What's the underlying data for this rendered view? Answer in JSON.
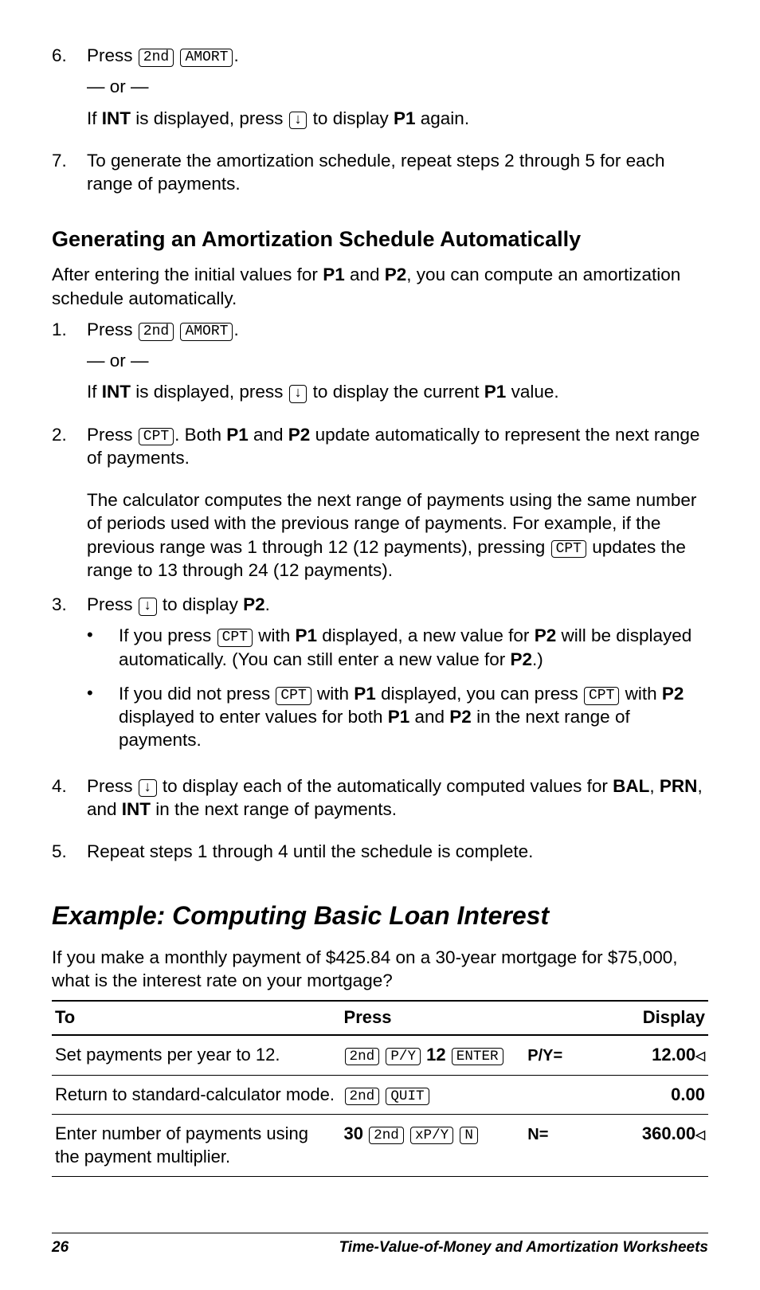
{
  "steps_top": [
    {
      "num": "6.",
      "parts": [
        "Press ",
        "[2nd]",
        " ",
        "[AMORT]",
        "."
      ],
      "or": "— or —",
      "parts2": [
        "If ",
        "**INT**",
        " is displayed, press ",
        "[↓]",
        " to display ",
        "**P1**",
        " again."
      ]
    },
    {
      "num": "7.",
      "parts": [
        "To generate the amortization schedule, repeat steps 2 through 5 for each range of payments."
      ]
    }
  ],
  "heading1": "Generating an Amortization Schedule Automatically",
  "intro1": [
    "After entering the initial values for ",
    "**P1**",
    " and ",
    "**P2**",
    ", you can compute an amortization schedule automatically."
  ],
  "steps_mid": [
    {
      "num": "1.",
      "parts": [
        "Press ",
        "[2nd]",
        " ",
        "[AMORT]",
        "."
      ],
      "or": "— or —",
      "parts2": [
        "If ",
        "**INT**",
        " is displayed, press ",
        "[↓]",
        " to display the current ",
        "**P1**",
        " value."
      ]
    },
    {
      "num": "2.",
      "parts": [
        "Press ",
        "[CPT]",
        ". Both ",
        "**P1**",
        " and ",
        "**P2**",
        " update automatically to represent the next range of payments."
      ],
      "para": [
        "The calculator computes the next range of payments using the same number of periods used with the previous range of payments. For example, if the previous range was 1 through 12 (12 payments), pressing ",
        "[CPT]",
        " updates the range to 13 through 24 (12 payments)."
      ]
    },
    {
      "num": "3.",
      "parts": [
        "Press ",
        "[↓]",
        " to display ",
        "**P2**",
        "."
      ],
      "bullets": [
        [
          "If you press ",
          "[CPT]",
          " with ",
          "**P1**",
          " displayed, a new value for ",
          "**P2**",
          " will be displayed automatically. (You can still enter a new value for ",
          "**P2**",
          ".)"
        ],
        [
          "If you did not press ",
          "[CPT]",
          " with ",
          "**P1**",
          " displayed, you can press ",
          "[CPT]",
          " with ",
          "**P2**",
          " displayed to enter values for both ",
          "**P1**",
          " and ",
          "**P2**",
          " in the next range of payments."
        ]
      ]
    },
    {
      "num": "4.",
      "parts": [
        "Press ",
        "[↓]",
        " to display each of the automatically computed values for ",
        "**BAL**",
        ", ",
        "**PRN**",
        ", and ",
        "**INT**",
        " in the next range of payments."
      ]
    },
    {
      "num": "5.",
      "parts": [
        "Repeat steps 1 through 4 until the schedule is complete."
      ]
    }
  ],
  "example_heading": "Example: Computing Basic Loan Interest",
  "example_intro": "If you make a monthly payment of $425.84 on a 30-year mortgage for $75,000, what is the interest rate on your mortgage?",
  "table": {
    "headers": [
      "To",
      "Press",
      "Display"
    ],
    "rows": [
      {
        "to": "Set payments per year to 12.",
        "press": [
          "[2nd]",
          " ",
          "[P/Y]",
          " ",
          "**12**",
          " ",
          "[ENTER]"
        ],
        "var": "P/Y=",
        "val": "12.00",
        "tri": true
      },
      {
        "to": "Return to standard-calculator mode.",
        "press": [
          "[2nd]",
          " ",
          "[QUIT]"
        ],
        "var": "",
        "val": "0.00",
        "tri": false
      },
      {
        "to": "Enter number of payments using the payment multiplier.",
        "press": [
          "**30**",
          " ",
          "[2nd]",
          " ",
          "[xP/Y]",
          " ",
          "[N]"
        ],
        "var": "N=",
        "val": "360.00",
        "tri": true
      }
    ]
  },
  "chart_data": {
    "type": "table",
    "headers": [
      "To",
      "Press",
      "Display variable",
      "Display value"
    ],
    "rows": [
      [
        "Set payments per year to 12.",
        "2nd P/Y 12 ENTER",
        "P/Y=",
        "12.00◁"
      ],
      [
        "Return to standard-calculator mode.",
        "2nd QUIT",
        "",
        "0.00"
      ],
      [
        "Enter number of payments using the payment multiplier.",
        "30 2nd xP/Y N",
        "N=",
        "360.00◁"
      ]
    ]
  },
  "footer": {
    "page": "26",
    "title": "Time-Value-of-Money and Amortization Worksheets"
  }
}
